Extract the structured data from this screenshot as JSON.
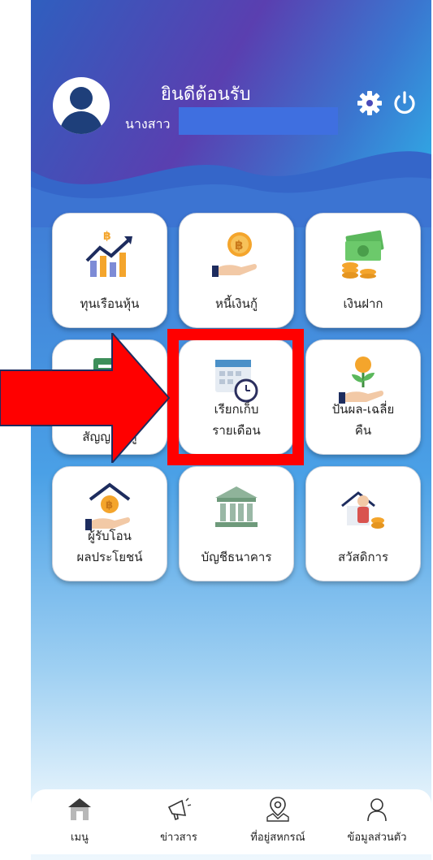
{
  "header": {
    "welcome": "ยินดีต้อนรับ",
    "name_prefix": "นางสาว"
  },
  "menu": [
    {
      "label": "ทุนเรือนหุ้น",
      "icon": "stock-growth-icon"
    },
    {
      "label": "หนี้เงินกู้",
      "icon": "coin-hand-icon"
    },
    {
      "label": "เงินฝาก",
      "icon": "money-stack-icon"
    },
    {
      "label": "สัญญา  นกู้",
      "icon": "contract-icon"
    },
    {
      "label_1": "เรียกเก็บ",
      "label_2": "รายเดือน",
      "icon": "calendar-clock-icon"
    },
    {
      "label_1": "ปันผล-เฉลี่ย",
      "label_2": "คืน",
      "icon": "plant-coin-icon"
    },
    {
      "label_1": "ผู้รับโอน",
      "label_2": "ผลประโยชน์",
      "icon": "house-coin-icon"
    },
    {
      "label": "บัญชีธนาคาร",
      "icon": "bank-icon"
    },
    {
      "label": "สวัสดิการ",
      "icon": "welfare-icon"
    }
  ],
  "nav": [
    {
      "label": "เมนู",
      "icon": "home-icon"
    },
    {
      "label": "ข่าวสาร",
      "icon": "megaphone-icon"
    },
    {
      "label": "ที่อยู่สหกรณ์",
      "icon": "map-pin-icon"
    },
    {
      "label": "ข้อมูลส่วนตัว",
      "icon": "person-icon"
    }
  ],
  "colors": {
    "highlight": "#ff0000",
    "accent_blue": "#3e7ad4"
  }
}
